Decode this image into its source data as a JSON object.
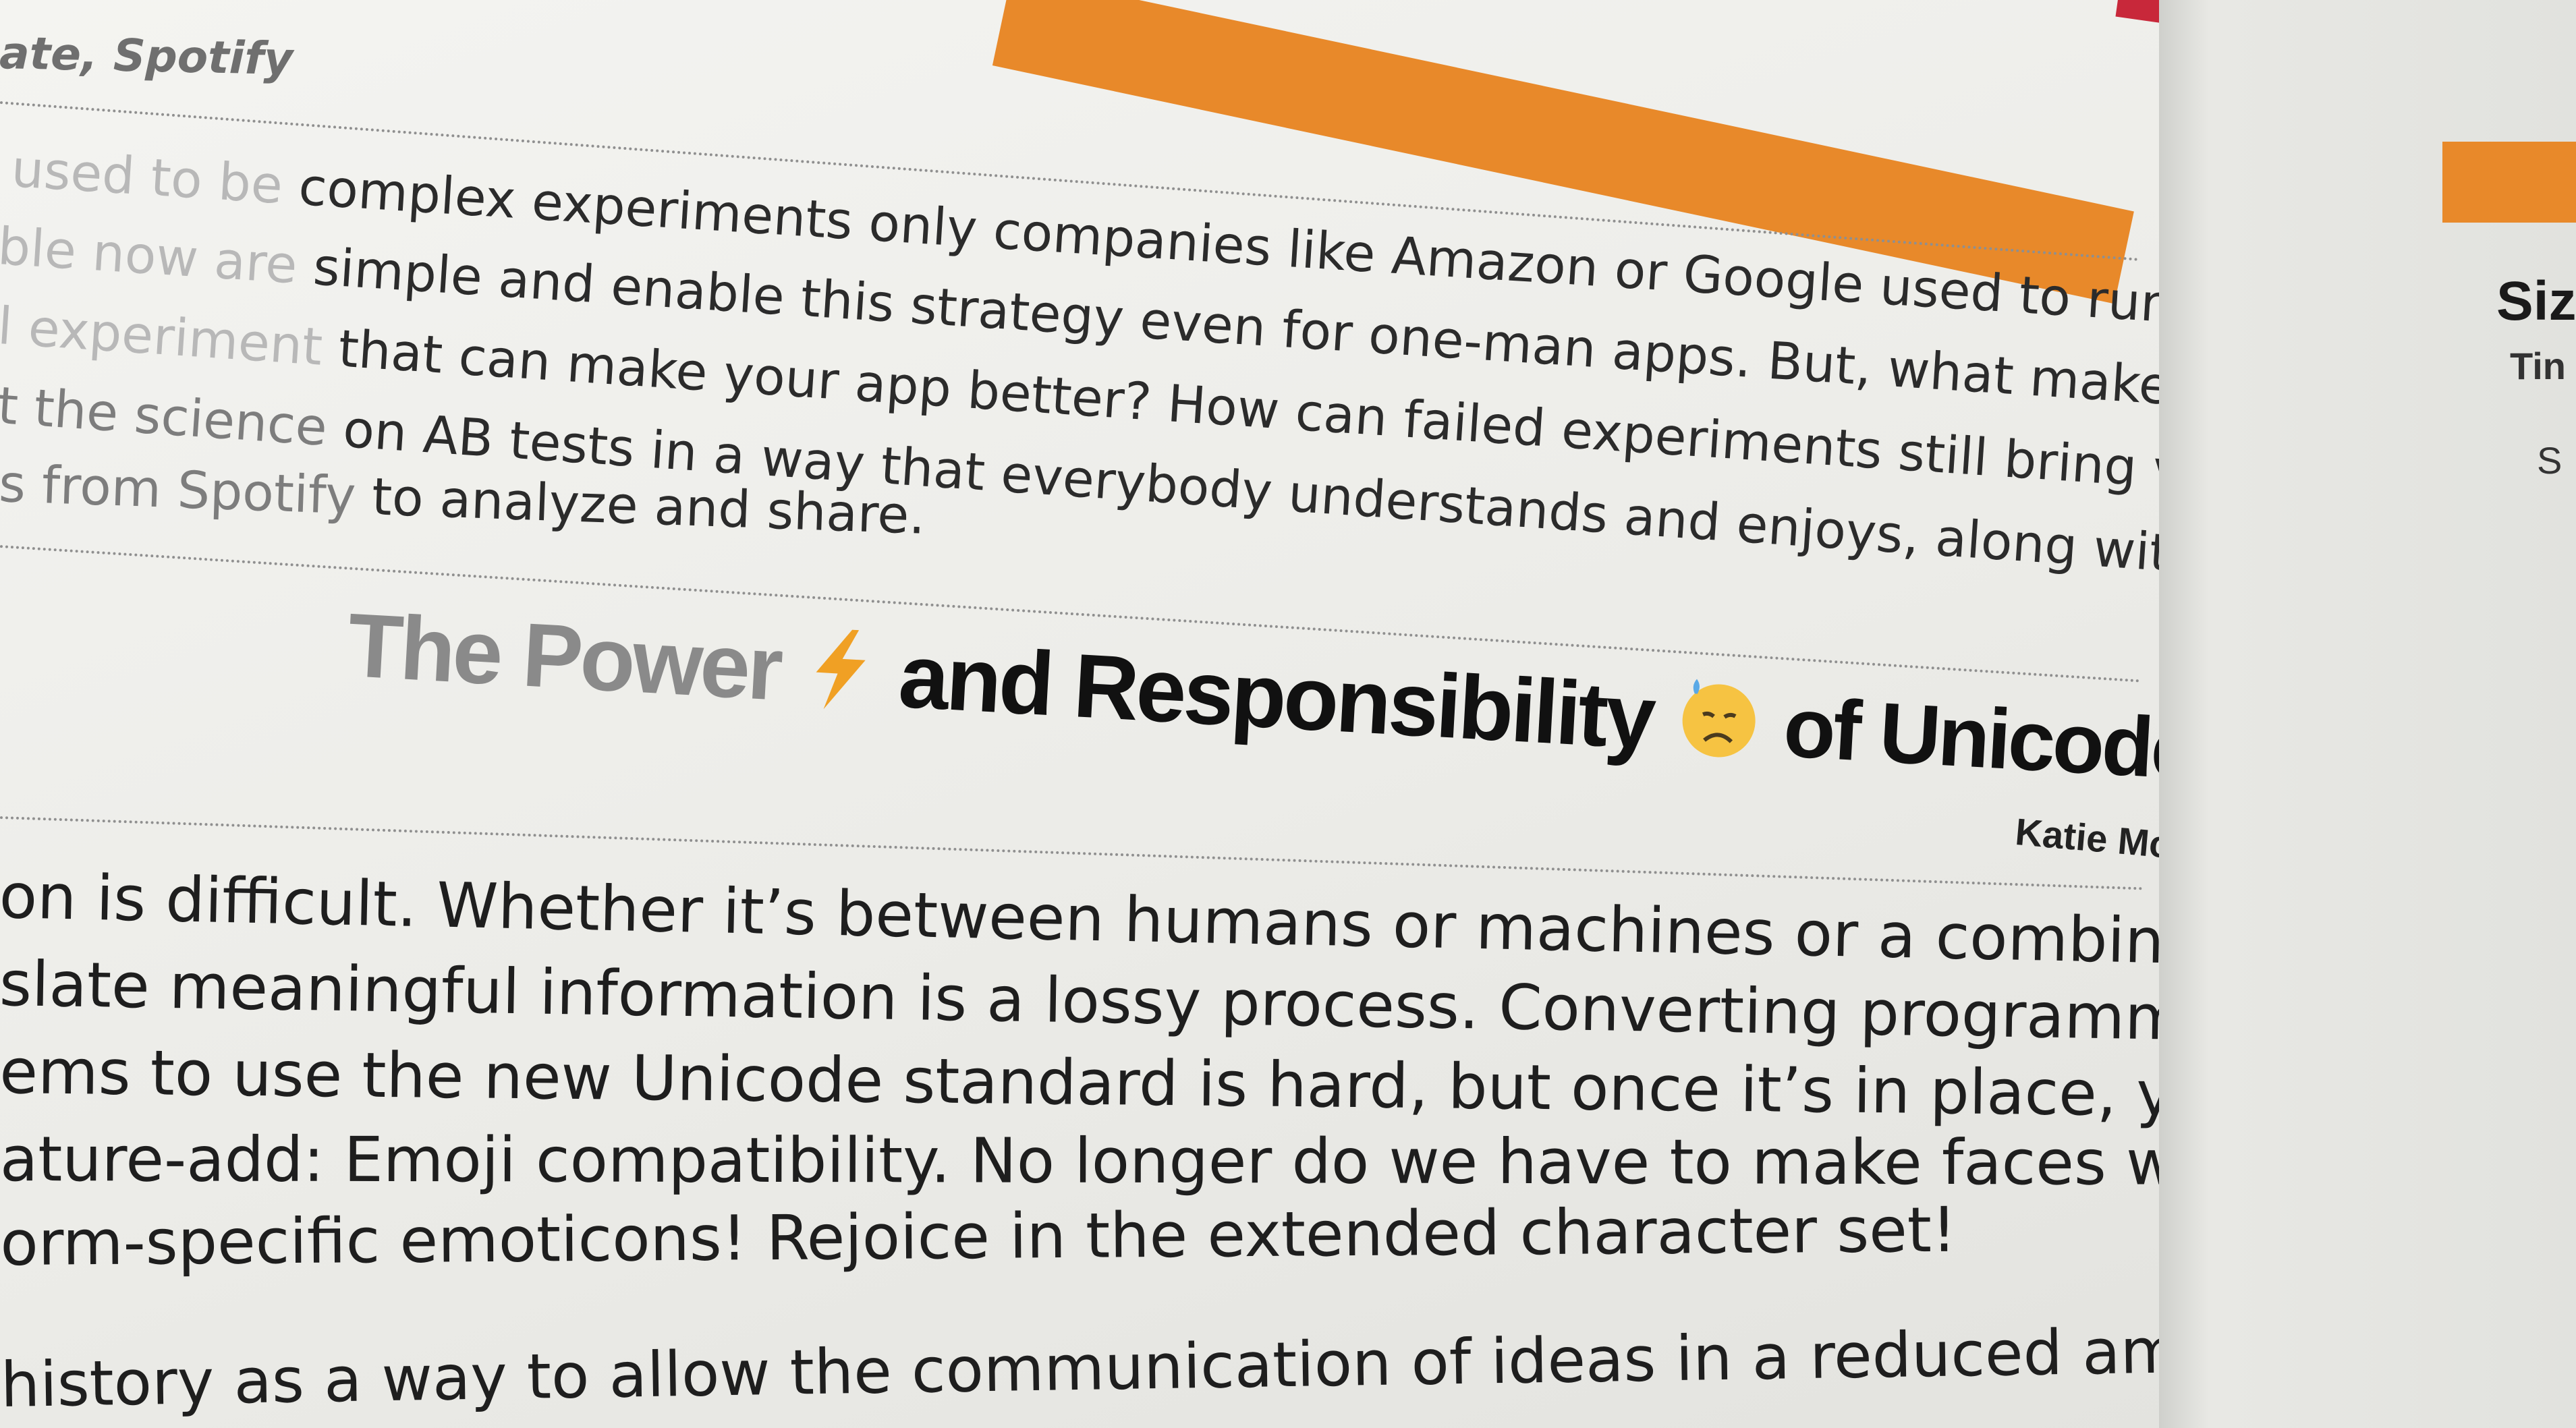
{
  "header": {
    "author": "ate, Spotify"
  },
  "intro": {
    "lines": [
      {
        "a": "used to be",
        "b": " complex experiments only companies like Amazon or Google used to run. The"
      },
      {
        "a": "ble now are",
        "b": " simple and enable this strategy even for one-man apps. But, what makes a"
      },
      {
        "a": "l experiment",
        "b": " that can make your app better? How can failed experiments still bring value?"
      },
      {
        "a": "t the science",
        "b": " on AB tests in a way that everybody understands and enjoys, along with some"
      },
      {
        "a": "s from Spotify",
        "b": " to analyze and share."
      }
    ]
  },
  "article": {
    "title_part1": "The Power",
    "title_part2": "and Responsibility",
    "title_part3": "of Unicode Adoption",
    "author": "Katie McLaughlin"
  },
  "body": {
    "lines": [
      "on is difficult. Whether it’s between humans or machines or a combination of the two,",
      "slate meaningful information is a lossy process. Converting programming languages and",
      "ems to use the new Unicode standard is hard, but once it’s in place, you get this",
      "ature-add: Emoji compatibility. No longer do we have to make faces with symbols, or be",
      "orm-specific emoticons! Rejoice in the extended character set!",
      "history as a way to allow the communication of ideas in a reduced amount of data, and"
    ]
  },
  "right_page": {
    "heading": "Siz",
    "sub": "Tin",
    "line": "S"
  },
  "colors": {
    "accent_orange": "#e8892a",
    "accent_red": "#c8283a"
  },
  "icons": [
    "lightning-icon",
    "sad-sweat-face-icon",
    "sparkles-icon"
  ]
}
